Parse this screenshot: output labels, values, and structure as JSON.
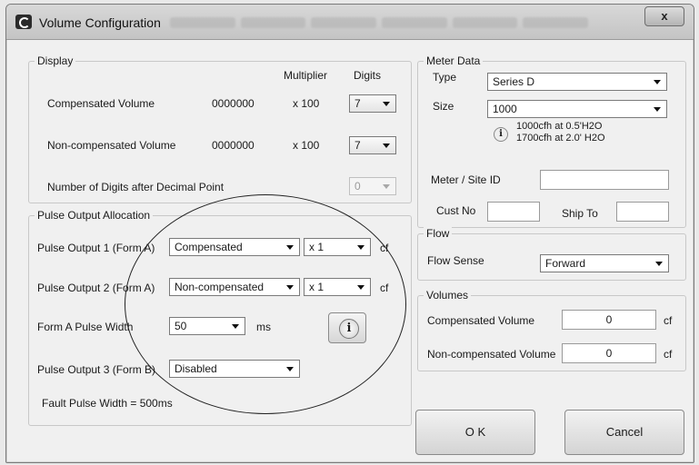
{
  "window": {
    "title": "Volume Configuration",
    "close_label": "x"
  },
  "display": {
    "legend": "Display",
    "multiplier_header": "Multiplier",
    "digits_header": "Digits",
    "rows": [
      {
        "label": "Compensated Volume",
        "value": "0000000",
        "multiplier": "x 100",
        "digits": "7"
      },
      {
        "label": "Non-compensated Volume",
        "value": "0000000",
        "multiplier": "x 100",
        "digits": "7"
      }
    ],
    "decimal_label": "Number of Digits after Decimal Point",
    "decimal_value": "0"
  },
  "pulse": {
    "legend": "Pulse Output Allocation",
    "out1_label": "Pulse Output 1 (Form A)",
    "out1_value": "Compensated",
    "out1_mult": "x 1",
    "out1_unit": "cf",
    "out2_label": "Pulse Output 2 (Form A)",
    "out2_value": "Non-compensated",
    "out2_mult": "x 1",
    "out2_unit": "cf",
    "width_label": "Form A Pulse Width",
    "width_value": "50",
    "width_unit": "ms",
    "out3_label": "Pulse Output 3 (Form B)",
    "out3_value": "Disabled",
    "fault_label": "Fault Pulse Width = 500ms"
  },
  "meter": {
    "legend": "Meter Data",
    "type_label": "Type",
    "type_value": "Series D",
    "size_label": "Size",
    "size_value": "1000",
    "info_line1": "1000cfh at 0.5'H2O",
    "info_line2": "1700cfh at 2.0' H2O",
    "site_label": "Meter / Site ID",
    "site_value": "",
    "cust_label": "Cust No",
    "cust_value": "",
    "ship_label": "Ship To",
    "ship_value": ""
  },
  "flow": {
    "legend": "Flow",
    "sense_label": "Flow Sense",
    "sense_value": "Forward"
  },
  "volumes": {
    "legend": "Volumes",
    "comp_label": "Compensated Volume",
    "comp_value": "0",
    "comp_unit": "cf",
    "noncomp_label": "Non-compensated Volume",
    "noncomp_value": "0",
    "noncomp_unit": "cf"
  },
  "buttons": {
    "ok": "O K",
    "cancel": "Cancel"
  },
  "icons": {
    "app": "gauge-icon",
    "info": "info-icon"
  }
}
